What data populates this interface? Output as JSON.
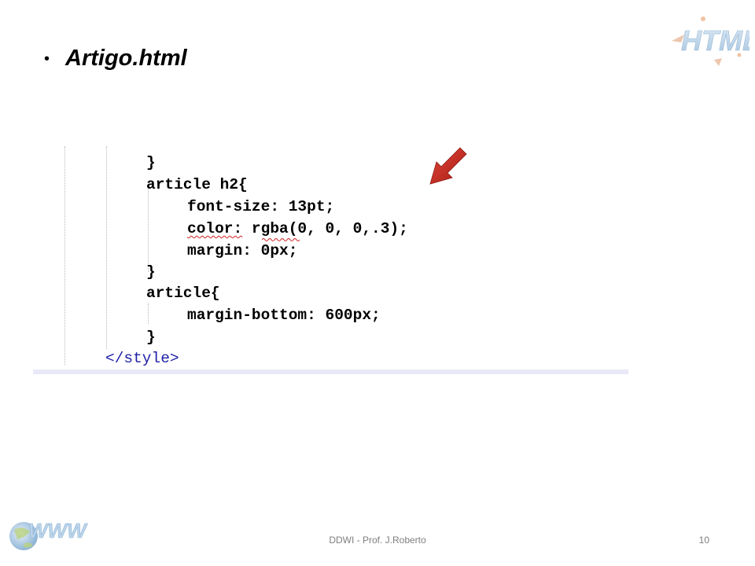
{
  "slide": {
    "bullet": "•",
    "heading": "Artigo.html",
    "logo_text": "HTML",
    "footer_www_text": "WWW",
    "footer_text": "DDWI - Prof. J.Roberto",
    "page_number": "10"
  },
  "code": {
    "lines": [
      "}",
      "article h2{",
      "font-size: 13pt;",
      "rgba(0, 0, 0,.3);",
      "margin: 0px;",
      "}",
      "article{",
      "margin-bottom: 600px;",
      "}",
      "</style>"
    ],
    "color_keyword": "color:",
    "squiggle_word": "rgba"
  },
  "colors": {
    "tag_blue": "#1f1fa8",
    "arrow_red": "#c4281c",
    "spell_underline": "#d02020",
    "footer_gray": "#7f7f7f",
    "panel_bar": "#e8e8f8"
  }
}
